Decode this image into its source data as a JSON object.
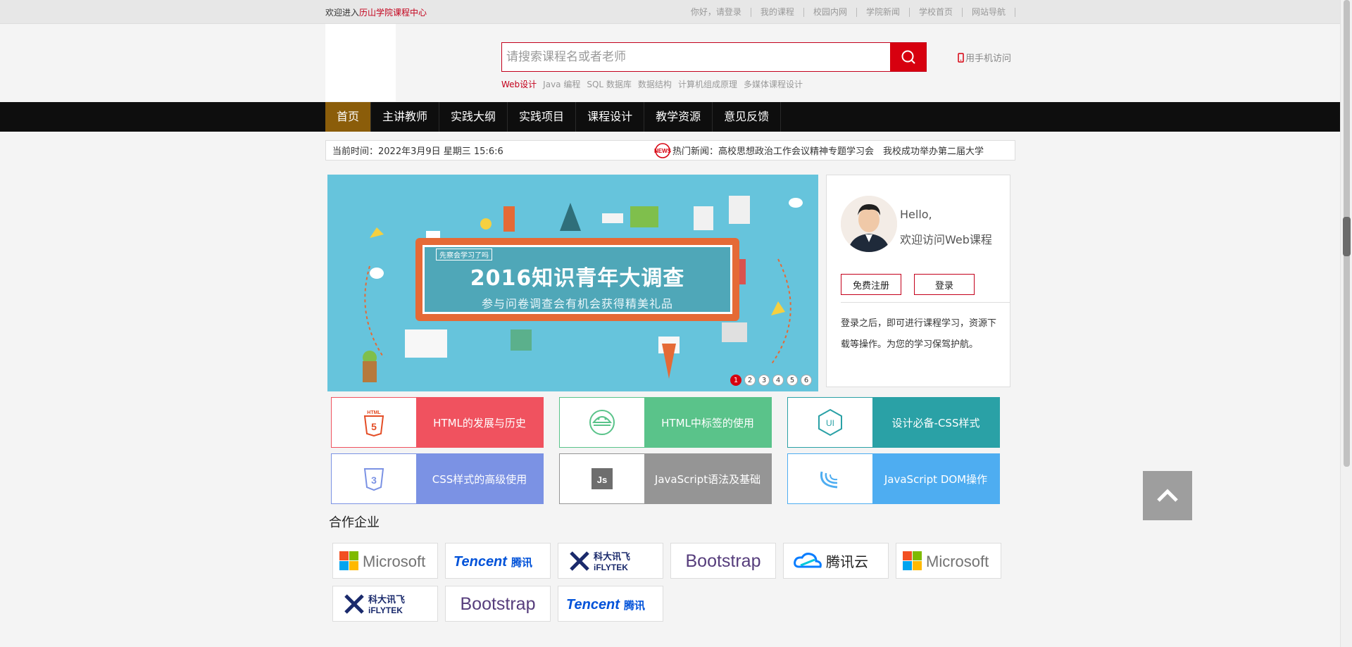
{
  "topbar": {
    "welcome_prefix": "欢迎进入",
    "welcome_site": "历山学院课程中心",
    "links": [
      "你好，请登录",
      "我的课程",
      "校园内网",
      "学院新闻",
      "学校首页",
      "网站导航"
    ]
  },
  "header": {
    "search_placeholder": "请搜索课程名或者老师",
    "hot_tags": [
      "Web设计",
      "Java 编程",
      "SQL 数据库",
      "数据结构",
      "计算机组成原理",
      "多媒体课程设计"
    ],
    "mobile_label": "用手机访问"
  },
  "nav": {
    "items": [
      "首页",
      "主讲教师",
      "实践大纲",
      "实践项目",
      "课程设计",
      "教学资源",
      "意见反馈"
    ],
    "active_index": 0
  },
  "infobar": {
    "time_text": "当前时间：2022年3月9日 星期三 15:6:6",
    "news_badge": "NEWS",
    "news_text": "热门新闻：高校思想政治工作会议精神专题学习会　我校成功举办第二届大学"
  },
  "banner": {
    "tag": "先察会学习了吗",
    "title": "2016知识青年大调查",
    "subtitle": "参与问卷调查会有机会获得精美礼品",
    "dots": [
      "1",
      "2",
      "3",
      "4",
      "5",
      "6"
    ],
    "active_dot": 0
  },
  "login_card": {
    "hello": "Hello,",
    "welcome": "欢迎访问Web课程",
    "register_label": "免费注册",
    "login_label": "登录",
    "description": "登录之后，即可进行课程学习，资源下载等操作。为您的学习保驾护航。"
  },
  "courses": [
    {
      "label": "HTML的发展与历史",
      "icon": "html5-icon",
      "color": "#f0525f"
    },
    {
      "label": "HTML中标签的使用",
      "icon": "android-icon",
      "color": "#5ac38a"
    },
    {
      "label": "设计必备-CSS样式",
      "icon": "ui-icon",
      "color": "#2aa1a6"
    },
    {
      "label": "CSS样式的高级使用",
      "icon": "css3-icon",
      "color": "#7b92e4"
    },
    {
      "label": "JavaScript语法及基础",
      "icon": "js-icon",
      "color": "#959595"
    },
    {
      "label": "JavaScript DOM操作",
      "icon": "jquery-icon",
      "color": "#4eadf1"
    }
  ],
  "partners_title": "合作企业",
  "partners": [
    {
      "name": "Microsoft",
      "icon": "microsoft-logo"
    },
    {
      "name": "Tencent腾讯",
      "icon": "tencent-logo"
    },
    {
      "name": "科大讯飞 iFLYTEK",
      "icon": "iflytek-logo"
    },
    {
      "name": "Bootstrap",
      "icon": "bootstrap-logo"
    },
    {
      "name": "腾讯云",
      "icon": "tencent-cloud-logo"
    },
    {
      "name": "Microsoft",
      "icon": "microsoft-logo"
    },
    {
      "name": "科大讯飞 iFLYTEK",
      "icon": "iflytek-logo"
    },
    {
      "name": "Bootstrap",
      "icon": "bootstrap-logo"
    },
    {
      "name": "Tencent腾讯",
      "icon": "tencent-logo"
    }
  ],
  "colors": {
    "accent": "#d7000f",
    "nav_bg": "#0e0e0e",
    "nav_active": "#8b5d0a",
    "banner_bg": "#66c4dc"
  }
}
